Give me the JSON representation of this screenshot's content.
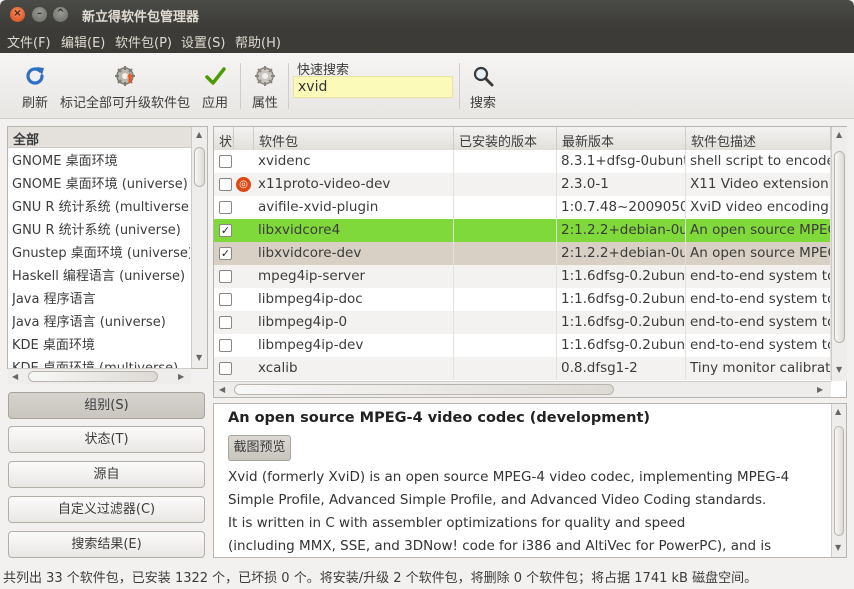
{
  "window": {
    "title": "新立得软件包管理器",
    "close_glyph": "×",
    "min_glyph": "–",
    "max_glyph": "^"
  },
  "menubar": [
    "文件(F)",
    "编辑(E)",
    "软件包(P)",
    "设置(S)",
    "帮助(H)"
  ],
  "toolbar": {
    "refresh": "刷新",
    "mark_upgrades": "标记全部可升级软件包",
    "apply": "应用",
    "properties": "属性",
    "quick_search_label": "快速搜索",
    "quick_search_value": "xvid",
    "search": "搜索"
  },
  "categories": {
    "header": "全部",
    "items": [
      "GNOME 桌面环境",
      "GNOME 桌面环境 (universe)",
      "GNU R 统计系统 (multiverse)",
      "GNU R 统计系统 (universe)",
      "Gnustep 桌面环境 (universe)",
      "Haskell 编程语言 (universe)",
      "Java 程序语言",
      "Java 程序语言 (universe)",
      "KDE 桌面环境",
      "KDE 桌面环境 (multiverse)"
    ]
  },
  "filter_buttons": [
    "组别(S)",
    "状态(T)",
    "源自",
    "自定义过滤器(C)",
    "搜索结果(E)"
  ],
  "columns": [
    "状态",
    "软件包",
    "已安装的版本",
    "最新版本",
    "软件包描述"
  ],
  "packages": [
    {
      "checked": "",
      "ubuntu": false,
      "name": "xvidenc",
      "installed": "",
      "latest": "8.3.1+dfsg-0ubuntu",
      "desc": "shell script to encode"
    },
    {
      "checked": "",
      "ubuntu": true,
      "name": "x11proto-video-dev",
      "installed": "",
      "latest": "2.3.0-1",
      "desc": "X11 Video extension"
    },
    {
      "checked": "",
      "ubuntu": false,
      "name": "avifile-xvid-plugin",
      "installed": "",
      "latest": "1:0.7.48~20090503",
      "desc": "XviD video encoding"
    },
    {
      "checked": "✓",
      "ubuntu": false,
      "name": "libxvidcore4",
      "installed": "",
      "latest": "2:1.2.2+debian-0ub",
      "desc": "An open source MPEG"
    },
    {
      "checked": "✓",
      "ubuntu": false,
      "name": "libxvidcore-dev",
      "installed": "",
      "latest": "2:1.2.2+debian-0ub",
      "desc": "An open source MPEG"
    },
    {
      "checked": "",
      "ubuntu": false,
      "name": "mpeg4ip-server",
      "installed": "",
      "latest": "1:1.6dfsg-0.2ubuntu",
      "desc": "end-to-end system to"
    },
    {
      "checked": "",
      "ubuntu": false,
      "name": "libmpeg4ip-doc",
      "installed": "",
      "latest": "1:1.6dfsg-0.2ubuntu",
      "desc": "end-to-end system to"
    },
    {
      "checked": "",
      "ubuntu": false,
      "name": "libmpeg4ip-0",
      "installed": "",
      "latest": "1:1.6dfsg-0.2ubuntu",
      "desc": "end-to-end system to"
    },
    {
      "checked": "",
      "ubuntu": false,
      "name": "libmpeg4ip-dev",
      "installed": "",
      "latest": "1:1.6dfsg-0.2ubuntu",
      "desc": "end-to-end system to"
    },
    {
      "checked": "",
      "ubuntu": false,
      "name": "xcalib",
      "installed": "",
      "latest": "0.8.dfsg1-2",
      "desc": "Tiny monitor calibrati"
    }
  ],
  "description": {
    "title": "An open source MPEG-4 video codec (development)",
    "screenshot_button": "截图预览",
    "lines": [
      "Xvid (formerly XviD) is an open source MPEG-4 video codec, implementing MPEG-4",
      "Simple Profile, Advanced Simple Profile, and Advanced Video Coding standards.",
      "It is written in C with assembler optimizations for quality and speed",
      "(including MMX, SSE, and 3DNow! code for i386 and AltiVec for PowerPC), and is"
    ]
  },
  "statusbar": "共列出 33 个软件包，已安装 1322 个，已坏损 0 个。将安装/升级 2 个软件包，将删除 0 个软件包；将占据 1741 kB 磁盘空间。",
  "colors": {
    "selected_row": "#7fd93a",
    "highlight_row": "#d8d0c4",
    "title_bar": "#3c3b37",
    "search_bg": "#fcfab9"
  }
}
